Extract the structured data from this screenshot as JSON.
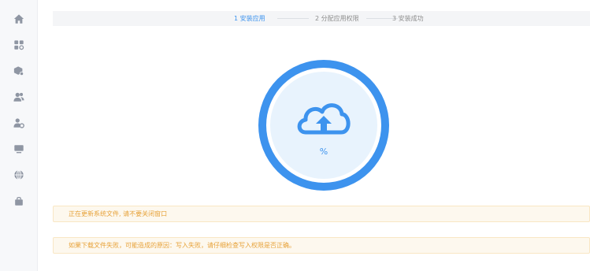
{
  "sidebar": {
    "items": [
      {
        "icon": "home-icon"
      },
      {
        "icon": "apps-grid-icon"
      },
      {
        "icon": "shield-cube-icon"
      },
      {
        "icon": "users-icon"
      },
      {
        "icon": "user-settings-icon"
      },
      {
        "icon": "monitor-icon"
      },
      {
        "icon": "globe-icon"
      },
      {
        "icon": "shopping-bag-icon"
      }
    ]
  },
  "steps": [
    {
      "label": "1 安装应用",
      "active": true
    },
    {
      "label": "2 分配应用权限",
      "active": false
    },
    {
      "label": "3 安装成功",
      "active": false
    }
  ],
  "progress": {
    "percent_text": "%",
    "icon": "cloud-upload-icon"
  },
  "notices": {
    "updating": "正在更新系统文件, 请不要关闭窗口",
    "failure_hint": "如果下载文件失败，可能造成的原因：写入失败，请仔细检查写入权限是否正确。"
  },
  "colors": {
    "accent": "#3d93ee",
    "ring_inner": "#e8f3fd",
    "warning_text": "#e7a239",
    "warning_bg": "#fdf8ee",
    "sidebar_icon": "#8f96a3"
  }
}
